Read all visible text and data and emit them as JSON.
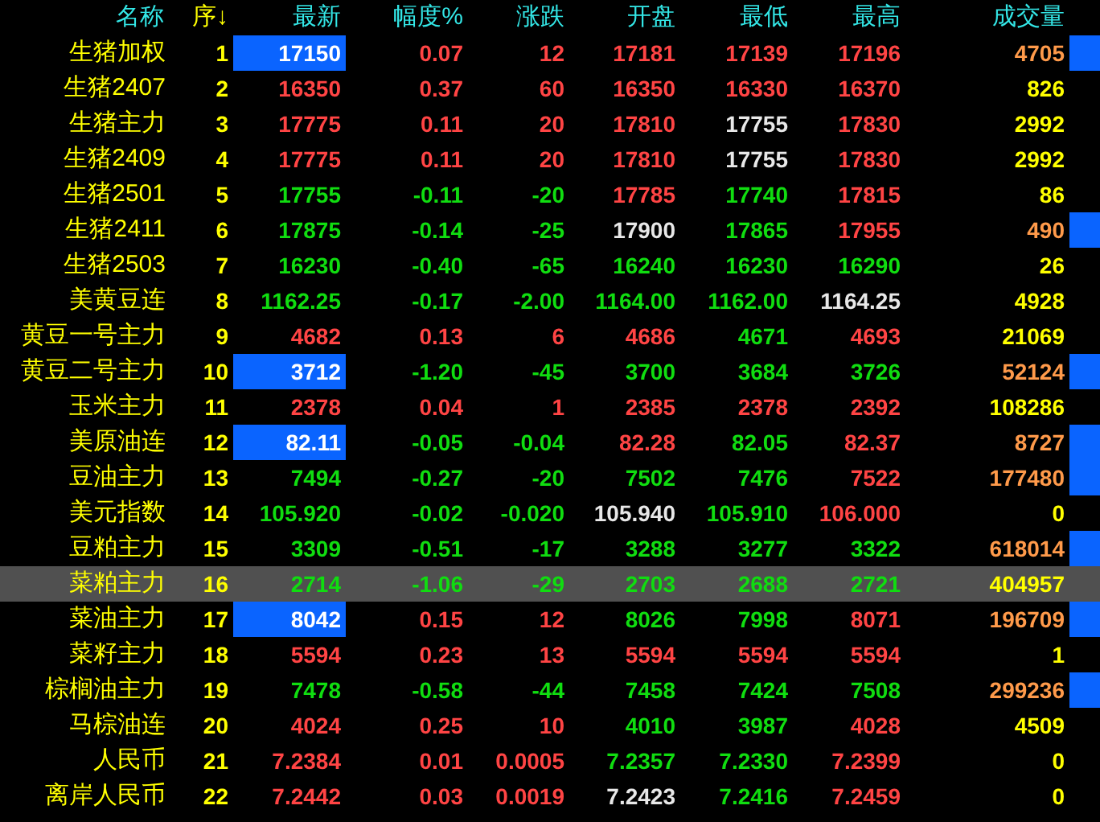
{
  "columns": [
    {
      "label": "名称",
      "kind": "name"
    },
    {
      "label": "序↓",
      "kind": "index"
    },
    {
      "label": "最新"
    },
    {
      "label": "幅度%"
    },
    {
      "label": "涨跌"
    },
    {
      "label": "开盘"
    },
    {
      "label": "最低"
    },
    {
      "label": "最高"
    },
    {
      "label": "成交量"
    }
  ],
  "rows": [
    {
      "name": "生猪加权",
      "no": "1",
      "selected": false,
      "marker": true,
      "latest": {
        "text": "17150",
        "flash": true
      },
      "pct": {
        "text": "0.07",
        "color": "#ff4444"
      },
      "change": {
        "text": "12",
        "color": "#ff4444"
      },
      "open": {
        "text": "17181",
        "color": "#ff4444"
      },
      "low": {
        "text": "17139",
        "color": "#ff4444"
      },
      "high": {
        "text": "17196",
        "color": "#ff4444"
      },
      "volume": {
        "text": "4705",
        "color": "#ff9a4a"
      }
    },
    {
      "name": "生猪2407",
      "no": "2",
      "selected": false,
      "marker": false,
      "latest": {
        "text": "16350",
        "color": "#ff4444",
        "flash": false
      },
      "pct": {
        "text": "0.37",
        "color": "#ff4444"
      },
      "change": {
        "text": "60",
        "color": "#ff4444"
      },
      "open": {
        "text": "16350",
        "color": "#ff4444"
      },
      "low": {
        "text": "16330",
        "color": "#ff4444"
      },
      "high": {
        "text": "16370",
        "color": "#ff4444"
      },
      "volume": {
        "text": "826",
        "color": "#ffff00"
      }
    },
    {
      "name": "生猪主力",
      "no": "3",
      "selected": false,
      "marker": false,
      "latest": {
        "text": "17775",
        "color": "#ff4444",
        "flash": false
      },
      "pct": {
        "text": "0.11",
        "color": "#ff4444"
      },
      "change": {
        "text": "20",
        "color": "#ff4444"
      },
      "open": {
        "text": "17810",
        "color": "#ff4444"
      },
      "low": {
        "text": "17755",
        "color": "#e8e8e8"
      },
      "high": {
        "text": "17830",
        "color": "#ff4444"
      },
      "volume": {
        "text": "2992",
        "color": "#ffff00"
      }
    },
    {
      "name": "生猪2409",
      "no": "4",
      "selected": false,
      "marker": false,
      "latest": {
        "text": "17775",
        "color": "#ff4444",
        "flash": false
      },
      "pct": {
        "text": "0.11",
        "color": "#ff4444"
      },
      "change": {
        "text": "20",
        "color": "#ff4444"
      },
      "open": {
        "text": "17810",
        "color": "#ff4444"
      },
      "low": {
        "text": "17755",
        "color": "#e8e8e8"
      },
      "high": {
        "text": "17830",
        "color": "#ff4444"
      },
      "volume": {
        "text": "2992",
        "color": "#ffff00"
      }
    },
    {
      "name": "生猪2501",
      "no": "5",
      "selected": false,
      "marker": false,
      "latest": {
        "text": "17755",
        "color": "#10dd10",
        "flash": false
      },
      "pct": {
        "text": "-0.11",
        "color": "#10dd10"
      },
      "change": {
        "text": "-20",
        "color": "#10dd10"
      },
      "open": {
        "text": "17785",
        "color": "#ff4444"
      },
      "low": {
        "text": "17740",
        "color": "#10dd10"
      },
      "high": {
        "text": "17815",
        "color": "#ff4444"
      },
      "volume": {
        "text": "86",
        "color": "#ffff00"
      }
    },
    {
      "name": "生猪2411",
      "no": "6",
      "selected": false,
      "marker": true,
      "latest": {
        "text": "17875",
        "color": "#10dd10",
        "flash": false
      },
      "pct": {
        "text": "-0.14",
        "color": "#10dd10"
      },
      "change": {
        "text": "-25",
        "color": "#10dd10"
      },
      "open": {
        "text": "17900",
        "color": "#e8e8e8"
      },
      "low": {
        "text": "17865",
        "color": "#10dd10"
      },
      "high": {
        "text": "17955",
        "color": "#ff4444"
      },
      "volume": {
        "text": "490",
        "color": "#ff9a4a"
      }
    },
    {
      "name": "生猪2503",
      "no": "7",
      "selected": false,
      "marker": false,
      "latest": {
        "text": "16230",
        "color": "#10dd10",
        "flash": false
      },
      "pct": {
        "text": "-0.40",
        "color": "#10dd10"
      },
      "change": {
        "text": "-65",
        "color": "#10dd10"
      },
      "open": {
        "text": "16240",
        "color": "#10dd10"
      },
      "low": {
        "text": "16230",
        "color": "#10dd10"
      },
      "high": {
        "text": "16290",
        "color": "#10dd10"
      },
      "volume": {
        "text": "26",
        "color": "#ffff00"
      }
    },
    {
      "name": "美黄豆连",
      "no": "8",
      "selected": false,
      "marker": false,
      "latest": {
        "text": "1162.25",
        "color": "#10dd10",
        "flash": false
      },
      "pct": {
        "text": "-0.17",
        "color": "#10dd10"
      },
      "change": {
        "text": "-2.00",
        "color": "#10dd10"
      },
      "open": {
        "text": "1164.00",
        "color": "#10dd10"
      },
      "low": {
        "text": "1162.00",
        "color": "#10dd10"
      },
      "high": {
        "text": "1164.25",
        "color": "#e8e8e8"
      },
      "volume": {
        "text": "4928",
        "color": "#ffff00"
      }
    },
    {
      "name": "黄豆一号主力",
      "no": "9",
      "selected": false,
      "marker": false,
      "latest": {
        "text": "4682",
        "color": "#ff4444",
        "flash": false
      },
      "pct": {
        "text": "0.13",
        "color": "#ff4444"
      },
      "change": {
        "text": "6",
        "color": "#ff4444"
      },
      "open": {
        "text": "4686",
        "color": "#ff4444"
      },
      "low": {
        "text": "4671",
        "color": "#10dd10"
      },
      "high": {
        "text": "4693",
        "color": "#ff4444"
      },
      "volume": {
        "text": "21069",
        "color": "#ffff00"
      }
    },
    {
      "name": "黄豆二号主力",
      "no": "10",
      "selected": false,
      "marker": true,
      "latest": {
        "text": "3712",
        "flash": true
      },
      "pct": {
        "text": "-1.20",
        "color": "#10dd10"
      },
      "change": {
        "text": "-45",
        "color": "#10dd10"
      },
      "open": {
        "text": "3700",
        "color": "#10dd10"
      },
      "low": {
        "text": "3684",
        "color": "#10dd10"
      },
      "high": {
        "text": "3726",
        "color": "#10dd10"
      },
      "volume": {
        "text": "52124",
        "color": "#ff9a4a"
      }
    },
    {
      "name": "玉米主力",
      "no": "11",
      "selected": false,
      "marker": false,
      "latest": {
        "text": "2378",
        "color": "#ff4444",
        "flash": false
      },
      "pct": {
        "text": "0.04",
        "color": "#ff4444"
      },
      "change": {
        "text": "1",
        "color": "#ff4444"
      },
      "open": {
        "text": "2385",
        "color": "#ff4444"
      },
      "low": {
        "text": "2378",
        "color": "#ff4444"
      },
      "high": {
        "text": "2392",
        "color": "#ff4444"
      },
      "volume": {
        "text": "108286",
        "color": "#ffff00"
      }
    },
    {
      "name": "美原油连",
      "no": "12",
      "selected": false,
      "marker": true,
      "latest": {
        "text": "82.11",
        "flash": true
      },
      "pct": {
        "text": "-0.05",
        "color": "#10dd10"
      },
      "change": {
        "text": "-0.04",
        "color": "#10dd10"
      },
      "open": {
        "text": "82.28",
        "color": "#ff4444"
      },
      "low": {
        "text": "82.05",
        "color": "#10dd10"
      },
      "high": {
        "text": "82.37",
        "color": "#ff4444"
      },
      "volume": {
        "text": "8727",
        "color": "#ff9a4a"
      }
    },
    {
      "name": "豆油主力",
      "no": "13",
      "selected": false,
      "marker": true,
      "latest": {
        "text": "7494",
        "color": "#10dd10",
        "flash": false
      },
      "pct": {
        "text": "-0.27",
        "color": "#10dd10"
      },
      "change": {
        "text": "-20",
        "color": "#10dd10"
      },
      "open": {
        "text": "7502",
        "color": "#10dd10"
      },
      "low": {
        "text": "7476",
        "color": "#10dd10"
      },
      "high": {
        "text": "7522",
        "color": "#ff4444"
      },
      "volume": {
        "text": "177480",
        "color": "#ff9a4a"
      }
    },
    {
      "name": "美元指数",
      "no": "14",
      "selected": false,
      "marker": false,
      "latest": {
        "text": "105.920",
        "color": "#10dd10",
        "flash": false
      },
      "pct": {
        "text": "-0.02",
        "color": "#10dd10"
      },
      "change": {
        "text": "-0.020",
        "color": "#10dd10"
      },
      "open": {
        "text": "105.940",
        "color": "#e8e8e8"
      },
      "low": {
        "text": "105.910",
        "color": "#10dd10"
      },
      "high": {
        "text": "106.000",
        "color": "#ff4444"
      },
      "volume": {
        "text": "0",
        "color": "#ffff00"
      }
    },
    {
      "name": "豆粕主力",
      "no": "15",
      "selected": false,
      "marker": true,
      "latest": {
        "text": "3309",
        "color": "#10dd10",
        "flash": false
      },
      "pct": {
        "text": "-0.51",
        "color": "#10dd10"
      },
      "change": {
        "text": "-17",
        "color": "#10dd10"
      },
      "open": {
        "text": "3288",
        "color": "#10dd10"
      },
      "low": {
        "text": "3277",
        "color": "#10dd10"
      },
      "high": {
        "text": "3322",
        "color": "#10dd10"
      },
      "volume": {
        "text": "618014",
        "color": "#ff9a4a"
      }
    },
    {
      "name": "菜粕主力",
      "no": "16",
      "selected": true,
      "marker": false,
      "latest": {
        "text": "2714",
        "color": "#10dd10",
        "flash": false
      },
      "pct": {
        "text": "-1.06",
        "color": "#10dd10"
      },
      "change": {
        "text": "-29",
        "color": "#10dd10"
      },
      "open": {
        "text": "2703",
        "color": "#10dd10"
      },
      "low": {
        "text": "2688",
        "color": "#10dd10"
      },
      "high": {
        "text": "2721",
        "color": "#10dd10"
      },
      "volume": {
        "text": "404957",
        "color": "#ffff00"
      }
    },
    {
      "name": "菜油主力",
      "no": "17",
      "selected": false,
      "marker": true,
      "latest": {
        "text": "8042",
        "flash": true
      },
      "pct": {
        "text": "0.15",
        "color": "#ff4444"
      },
      "change": {
        "text": "12",
        "color": "#ff4444"
      },
      "open": {
        "text": "8026",
        "color": "#10dd10"
      },
      "low": {
        "text": "7998",
        "color": "#10dd10"
      },
      "high": {
        "text": "8071",
        "color": "#ff4444"
      },
      "volume": {
        "text": "196709",
        "color": "#ff9a4a"
      }
    },
    {
      "name": "菜籽主力",
      "no": "18",
      "selected": false,
      "marker": false,
      "latest": {
        "text": "5594",
        "color": "#ff4444",
        "flash": false
      },
      "pct": {
        "text": "0.23",
        "color": "#ff4444"
      },
      "change": {
        "text": "13",
        "color": "#ff4444"
      },
      "open": {
        "text": "5594",
        "color": "#ff4444"
      },
      "low": {
        "text": "5594",
        "color": "#ff4444"
      },
      "high": {
        "text": "5594",
        "color": "#ff4444"
      },
      "volume": {
        "text": "1",
        "color": "#ffff00"
      }
    },
    {
      "name": "棕榈油主力",
      "no": "19",
      "selected": false,
      "marker": true,
      "latest": {
        "text": "7478",
        "color": "#10dd10",
        "flash": false
      },
      "pct": {
        "text": "-0.58",
        "color": "#10dd10"
      },
      "change": {
        "text": "-44",
        "color": "#10dd10"
      },
      "open": {
        "text": "7458",
        "color": "#10dd10"
      },
      "low": {
        "text": "7424",
        "color": "#10dd10"
      },
      "high": {
        "text": "7508",
        "color": "#10dd10"
      },
      "volume": {
        "text": "299236",
        "color": "#ff9a4a"
      }
    },
    {
      "name": "马棕油连",
      "no": "20",
      "selected": false,
      "marker": false,
      "latest": {
        "text": "4024",
        "color": "#ff4444",
        "flash": false
      },
      "pct": {
        "text": "0.25",
        "color": "#ff4444"
      },
      "change": {
        "text": "10",
        "color": "#ff4444"
      },
      "open": {
        "text": "4010",
        "color": "#10dd10"
      },
      "low": {
        "text": "3987",
        "color": "#10dd10"
      },
      "high": {
        "text": "4028",
        "color": "#ff4444"
      },
      "volume": {
        "text": "4509",
        "color": "#ffff00"
      }
    },
    {
      "name": "人民币",
      "no": "21",
      "selected": false,
      "marker": false,
      "latest": {
        "text": "7.2384",
        "color": "#ff4444",
        "flash": false
      },
      "pct": {
        "text": "0.01",
        "color": "#ff4444"
      },
      "change": {
        "text": "0.0005",
        "color": "#ff4444"
      },
      "open": {
        "text": "7.2357",
        "color": "#10dd10"
      },
      "low": {
        "text": "7.2330",
        "color": "#10dd10"
      },
      "high": {
        "text": "7.2399",
        "color": "#ff4444"
      },
      "volume": {
        "text": "0",
        "color": "#ffff00"
      }
    },
    {
      "name": "离岸人民币",
      "no": "22",
      "selected": false,
      "marker": false,
      "latest": {
        "text": "7.2442",
        "color": "#ff4444",
        "flash": false
      },
      "pct": {
        "text": "0.03",
        "color": "#ff4444"
      },
      "change": {
        "text": "0.0019",
        "color": "#ff4444"
      },
      "open": {
        "text": "7.2423",
        "color": "#e8e8e8"
      },
      "low": {
        "text": "7.2416",
        "color": "#10dd10"
      },
      "high": {
        "text": "7.2459",
        "color": "#ff4444"
      },
      "volume": {
        "text": "0",
        "color": "#ffff00"
      }
    }
  ]
}
